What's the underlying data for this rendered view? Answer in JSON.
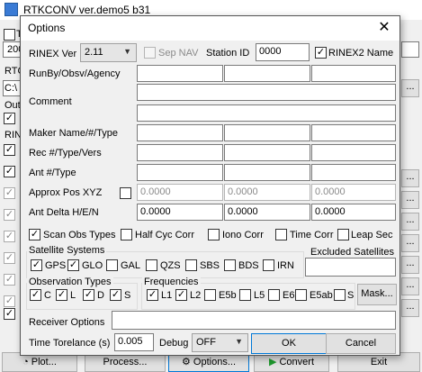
{
  "main": {
    "title": "RTKCONV ver.demo5 b31",
    "bottom_buttons": {
      "plot": "Plot...",
      "process": "Process...",
      "options": "Options...",
      "convert": "Convert",
      "exit": "Exit"
    },
    "left_fragments": {
      "rtc": "RTC",
      "c_path": "C:\\",
      "out": "Out",
      "rin": "RIN",
      "t": "T",
      "n200": "200"
    }
  },
  "dialog": {
    "title": "Options",
    "close": "✕",
    "rinex_ver": {
      "label": "RINEX Ver",
      "value": "2.11"
    },
    "sep_nav": {
      "label": "Sep NAV",
      "checked": false
    },
    "station_id": {
      "label": "Station ID",
      "value": "0000"
    },
    "rinex2_name": {
      "label": "RINEX2 Name",
      "checked": true
    },
    "runby": {
      "label": "RunBy/Obsv/Agency",
      "values": [
        "",
        "",
        ""
      ]
    },
    "comment": {
      "label": "Comment",
      "values": [
        "",
        ""
      ]
    },
    "maker": {
      "label": "Maker Name/#/Type",
      "values": [
        "",
        "",
        ""
      ]
    },
    "rec": {
      "label": "Rec #/Type/Vers",
      "values": [
        "",
        "",
        ""
      ]
    },
    "ant": {
      "label": "Ant #/Type",
      "values": [
        "",
        "",
        ""
      ]
    },
    "approx_pos": {
      "label": "Approx Pos XYZ",
      "checked": false,
      "values": [
        "0.0000",
        "0.0000",
        "0.0000"
      ]
    },
    "ant_delta": {
      "label": "Ant Delta H/E/N",
      "values": [
        "0.0000",
        "0.0000",
        "0.0000"
      ]
    },
    "options_row": {
      "scan_obs": {
        "label": "Scan Obs Types",
        "checked": true
      },
      "half_cyc": {
        "label": "Half Cyc Corr",
        "checked": false
      },
      "iono_corr": {
        "label": "Iono Corr",
        "checked": false
      },
      "time_corr": {
        "label": "Time Corr",
        "checked": false
      },
      "leap_sec": {
        "label": "Leap Sec",
        "checked": false
      }
    },
    "satellite_systems": {
      "title": "Satellite Systems",
      "items": [
        {
          "label": "GPS",
          "checked": true
        },
        {
          "label": "GLO",
          "checked": true
        },
        {
          "label": "GAL",
          "checked": false
        },
        {
          "label": "QZS",
          "checked": false
        },
        {
          "label": "SBS",
          "checked": false
        },
        {
          "label": "BDS",
          "checked": false
        },
        {
          "label": "IRN",
          "checked": false
        }
      ]
    },
    "excluded_satellites": {
      "label": "Excluded Satellites",
      "value": ""
    },
    "observation_types": {
      "title": "Observation Types",
      "items": [
        {
          "label": "C",
          "checked": true
        },
        {
          "label": "L",
          "checked": true
        },
        {
          "label": "D",
          "checked": true
        },
        {
          "label": "S",
          "checked": true
        }
      ]
    },
    "frequencies": {
      "title": "Frequencies",
      "items": [
        {
          "label": "L1",
          "checked": true
        },
        {
          "label": "L2",
          "checked": true
        },
        {
          "label": "E5b",
          "checked": false
        },
        {
          "label": "L5",
          "checked": false
        },
        {
          "label": "E6",
          "checked": false
        },
        {
          "label": "E5ab",
          "checked": false
        },
        {
          "label": "S",
          "checked": false
        }
      ]
    },
    "mask_button": "Mask...",
    "receiver_options": {
      "label": "Receiver Options",
      "value": ""
    },
    "time_tolerance": {
      "label": "Time Torelance (s)",
      "value": "0.005"
    },
    "debug": {
      "label": "Debug",
      "value": "OFF"
    },
    "ok": "OK",
    "cancel": "Cancel"
  }
}
